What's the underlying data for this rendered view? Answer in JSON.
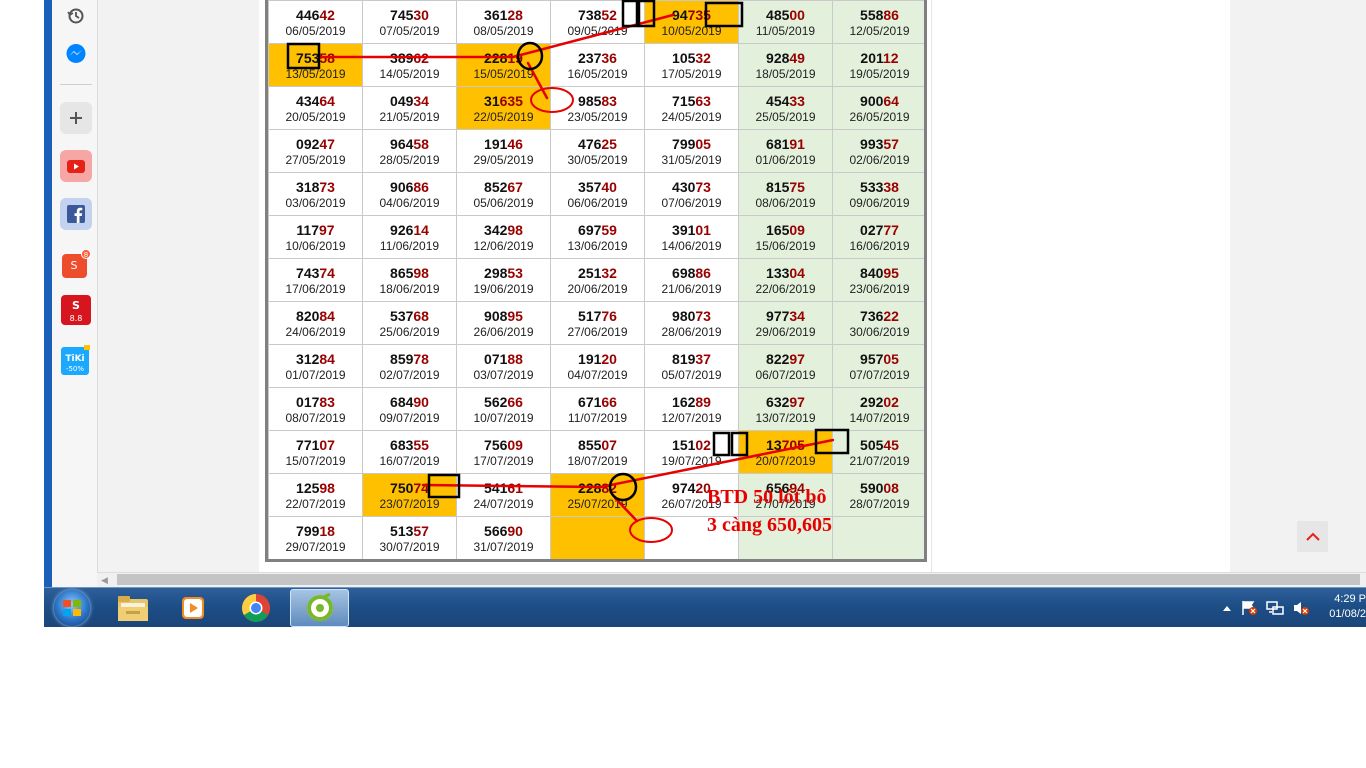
{
  "calendar": {
    "rows": [
      [
        {
          "p1": "446",
          "p2": "42",
          "date": "06/05/2019"
        },
        {
          "p1": "745",
          "p2": "30",
          "date": "07/05/2019"
        },
        {
          "p1": "361",
          "p2": "28",
          "date": "08/05/2019"
        },
        {
          "p1": "738",
          "p2": "52",
          "date": "09/05/2019"
        },
        {
          "p1": "94",
          "p2": "735",
          "date": "10/05/2019"
        },
        {
          "p1": "485",
          "p2": "00",
          "date": "11/05/2019"
        },
        {
          "p1": "558",
          "p2": "86",
          "date": "12/05/2019"
        }
      ],
      [
        {
          "p1": "753",
          "p2": "58",
          "date": "13/05/2019"
        },
        {
          "p1": "389",
          "p2": "62",
          "date": "14/05/2019"
        },
        {
          "p1": "228",
          "p2": "19",
          "date": "15/05/2019"
        },
        {
          "p1": "237",
          "p2": "36",
          "date": "16/05/2019"
        },
        {
          "p1": "105",
          "p2": "32",
          "date": "17/05/2019"
        },
        {
          "p1": "928",
          "p2": "49",
          "date": "18/05/2019"
        },
        {
          "p1": "201",
          "p2": "12",
          "date": "19/05/2019"
        }
      ],
      [
        {
          "p1": "434",
          "p2": "64",
          "date": "20/05/2019"
        },
        {
          "p1": "049",
          "p2": "34",
          "date": "21/05/2019"
        },
        {
          "p1": "31",
          "p2": "635",
          "date": "22/05/2019"
        },
        {
          "p1": "985",
          "p2": "83",
          "date": "23/05/2019"
        },
        {
          "p1": "715",
          "p2": "63",
          "date": "24/05/2019"
        },
        {
          "p1": "454",
          "p2": "33",
          "date": "25/05/2019"
        },
        {
          "p1": "900",
          "p2": "64",
          "date": "26/05/2019"
        }
      ],
      [
        {
          "p1": "092",
          "p2": "47",
          "date": "27/05/2019"
        },
        {
          "p1": "964",
          "p2": "58",
          "date": "28/05/2019"
        },
        {
          "p1": "191",
          "p2": "46",
          "date": "29/05/2019"
        },
        {
          "p1": "476",
          "p2": "25",
          "date": "30/05/2019"
        },
        {
          "p1": "799",
          "p2": "05",
          "date": "31/05/2019"
        },
        {
          "p1": "681",
          "p2": "91",
          "date": "01/06/2019"
        },
        {
          "p1": "993",
          "p2": "57",
          "date": "02/06/2019"
        }
      ],
      [
        {
          "p1": "318",
          "p2": "73",
          "date": "03/06/2019"
        },
        {
          "p1": "906",
          "p2": "86",
          "date": "04/06/2019"
        },
        {
          "p1": "852",
          "p2": "67",
          "date": "05/06/2019"
        },
        {
          "p1": "357",
          "p2": "40",
          "date": "06/06/2019"
        },
        {
          "p1": "430",
          "p2": "73",
          "date": "07/06/2019"
        },
        {
          "p1": "815",
          "p2": "75",
          "date": "08/06/2019"
        },
        {
          "p1": "533",
          "p2": "38",
          "date": "09/06/2019"
        }
      ],
      [
        {
          "p1": "117",
          "p2": "97",
          "date": "10/06/2019"
        },
        {
          "p1": "926",
          "p2": "14",
          "date": "11/06/2019"
        },
        {
          "p1": "342",
          "p2": "98",
          "date": "12/06/2019"
        },
        {
          "p1": "697",
          "p2": "59",
          "date": "13/06/2019"
        },
        {
          "p1": "391",
          "p2": "01",
          "date": "14/06/2019"
        },
        {
          "p1": "165",
          "p2": "09",
          "date": "15/06/2019"
        },
        {
          "p1": "027",
          "p2": "77",
          "date": "16/06/2019"
        }
      ],
      [
        {
          "p1": "743",
          "p2": "74",
          "date": "17/06/2019"
        },
        {
          "p1": "865",
          "p2": "98",
          "date": "18/06/2019"
        },
        {
          "p1": "298",
          "p2": "53",
          "date": "19/06/2019"
        },
        {
          "p1": "251",
          "p2": "32",
          "date": "20/06/2019"
        },
        {
          "p1": "698",
          "p2": "86",
          "date": "21/06/2019"
        },
        {
          "p1": "133",
          "p2": "04",
          "date": "22/06/2019"
        },
        {
          "p1": "840",
          "p2": "95",
          "date": "23/06/2019"
        }
      ],
      [
        {
          "p1": "820",
          "p2": "84",
          "date": "24/06/2019"
        },
        {
          "p1": "537",
          "p2": "68",
          "date": "25/06/2019"
        },
        {
          "p1": "908",
          "p2": "95",
          "date": "26/06/2019"
        },
        {
          "p1": "517",
          "p2": "76",
          "date": "27/06/2019"
        },
        {
          "p1": "980",
          "p2": "73",
          "date": "28/06/2019"
        },
        {
          "p1": "977",
          "p2": "34",
          "date": "29/06/2019"
        },
        {
          "p1": "736",
          "p2": "22",
          "date": "30/06/2019"
        }
      ],
      [
        {
          "p1": "312",
          "p2": "84",
          "date": "01/07/2019"
        },
        {
          "p1": "859",
          "p2": "78",
          "date": "02/07/2019"
        },
        {
          "p1": "071",
          "p2": "88",
          "date": "03/07/2019"
        },
        {
          "p1": "191",
          "p2": "20",
          "date": "04/07/2019"
        },
        {
          "p1": "819",
          "p2": "37",
          "date": "05/07/2019"
        },
        {
          "p1": "822",
          "p2": "97",
          "date": "06/07/2019"
        },
        {
          "p1": "957",
          "p2": "05",
          "date": "07/07/2019"
        }
      ],
      [
        {
          "p1": "017",
          "p2": "83",
          "date": "08/07/2019"
        },
        {
          "p1": "684",
          "p2": "90",
          "date": "09/07/2019"
        },
        {
          "p1": "562",
          "p2": "66",
          "date": "10/07/2019"
        },
        {
          "p1": "671",
          "p2": "66",
          "date": "11/07/2019"
        },
        {
          "p1": "162",
          "p2": "89",
          "date": "12/07/2019"
        },
        {
          "p1": "632",
          "p2": "97",
          "date": "13/07/2019"
        },
        {
          "p1": "292",
          "p2": "02",
          "date": "14/07/2019"
        }
      ],
      [
        {
          "p1": "771",
          "p2": "07",
          "date": "15/07/2019"
        },
        {
          "p1": "683",
          "p2": "55",
          "date": "16/07/2019"
        },
        {
          "p1": "756",
          "p2": "09",
          "date": "17/07/2019"
        },
        {
          "p1": "855",
          "p2": "07",
          "date": "18/07/2019"
        },
        {
          "p1": "151",
          "p2": "02",
          "date": "19/07/2019"
        },
        {
          "p1": "13",
          "p2": "705",
          "date": "20/07/2019"
        },
        {
          "p1": "505",
          "p2": "45",
          "date": "21/07/2019"
        }
      ],
      [
        {
          "p1": "125",
          "p2": "98",
          "date": "22/07/2019"
        },
        {
          "p1": "750",
          "p2": "74",
          "date": "23/07/2019"
        },
        {
          "p1": "541",
          "p2": "61",
          "date": "24/07/2019"
        },
        {
          "p1": "228",
          "p2": "82",
          "date": "25/07/2019"
        },
        {
          "p1": "974",
          "p2": "20",
          "date": "26/07/2019"
        },
        {
          "p1": "656",
          "p2": "94",
          "date": "27/07/2019"
        },
        {
          "p1": "590",
          "p2": "08",
          "date": "28/07/2019"
        }
      ],
      [
        {
          "p1": "799",
          "p2": "18",
          "date": "29/07/2019"
        },
        {
          "p1": "513",
          "p2": "57",
          "date": "30/07/2019"
        },
        {
          "p1": "566",
          "p2": "90",
          "date": "31/07/2019"
        },
        {
          "p1": "",
          "p2": "",
          "date": ""
        },
        {
          "p1": "",
          "p2": "",
          "date": ""
        },
        {
          "p1": "",
          "p2": "",
          "date": ""
        },
        {
          "p1": "",
          "p2": "",
          "date": ""
        }
      ]
    ],
    "highlighted_cells": [
      "0-4",
      "1-0",
      "1-2",
      "2-2",
      "10-5",
      "11-1",
      "11-3",
      "12-3"
    ]
  },
  "annotation": {
    "line1": "BTD 50 lót bô",
    "line2": "3 càng 650,605",
    "color": "#e60000"
  },
  "sidebar": {
    "items": [
      {
        "name": "history-icon"
      },
      {
        "name": "messenger-icon"
      },
      {
        "name": "add-icon"
      },
      {
        "name": "youtube-icon"
      },
      {
        "name": "facebook-icon"
      },
      {
        "name": "shopee-icon",
        "badge": "8"
      },
      {
        "name": "sendo-icon",
        "text": "8.8"
      },
      {
        "name": "tiki-icon",
        "text": "TiKi",
        "sub": "-50%"
      }
    ]
  },
  "taskbar": {
    "apps": [
      "file-explorer-icon",
      "media-player-icon",
      "chrome-icon",
      "coc-coc-browser-icon"
    ],
    "clock_time": "4:29 P",
    "clock_date": "01/08/2"
  },
  "colors": {
    "highlight": "#ffc000",
    "weekend": "#e3f1dc",
    "accent_red": "#990000"
  }
}
